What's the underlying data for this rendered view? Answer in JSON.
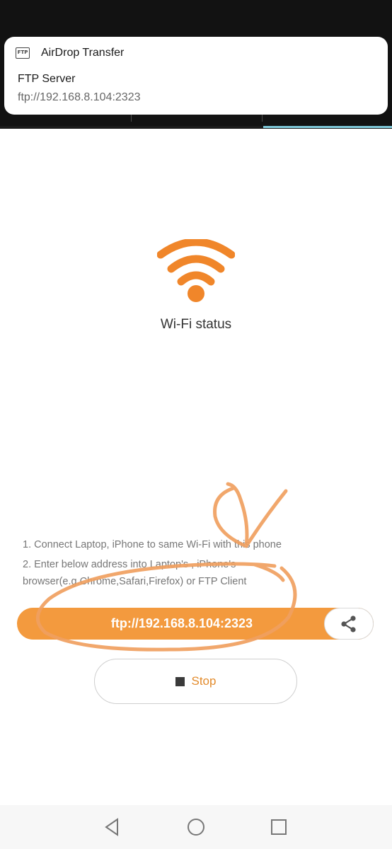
{
  "notification": {
    "app_name": "AirDrop Transfer",
    "app_icon": "ftp-icon",
    "app_icon_text": "FTP",
    "title": "FTP Server",
    "text": "ftp://192.168.8.104:2323"
  },
  "wifi": {
    "icon": "wifi-icon",
    "status_label": "Wi-Fi status",
    "color": "#f0862a"
  },
  "instructions": {
    "line1": "1. Connect Laptop, iPhone to same Wi-Fi with this phone",
    "line2": "2. Enter below address into Laptop's , iPhone's",
    "line3": "browser(e.g.Chrome,Safari,Firefox) or FTP Client"
  },
  "ftp": {
    "address": "ftp://192.168.8.104:2323",
    "accent_color": "#f39a3e",
    "share_icon": "share-icon"
  },
  "stop": {
    "label": "Stop",
    "icon": "stop-square-icon"
  },
  "nav": {
    "back_icon": "back-triangle-icon",
    "home_icon": "home-circle-icon",
    "recents_icon": "recents-square-icon"
  }
}
